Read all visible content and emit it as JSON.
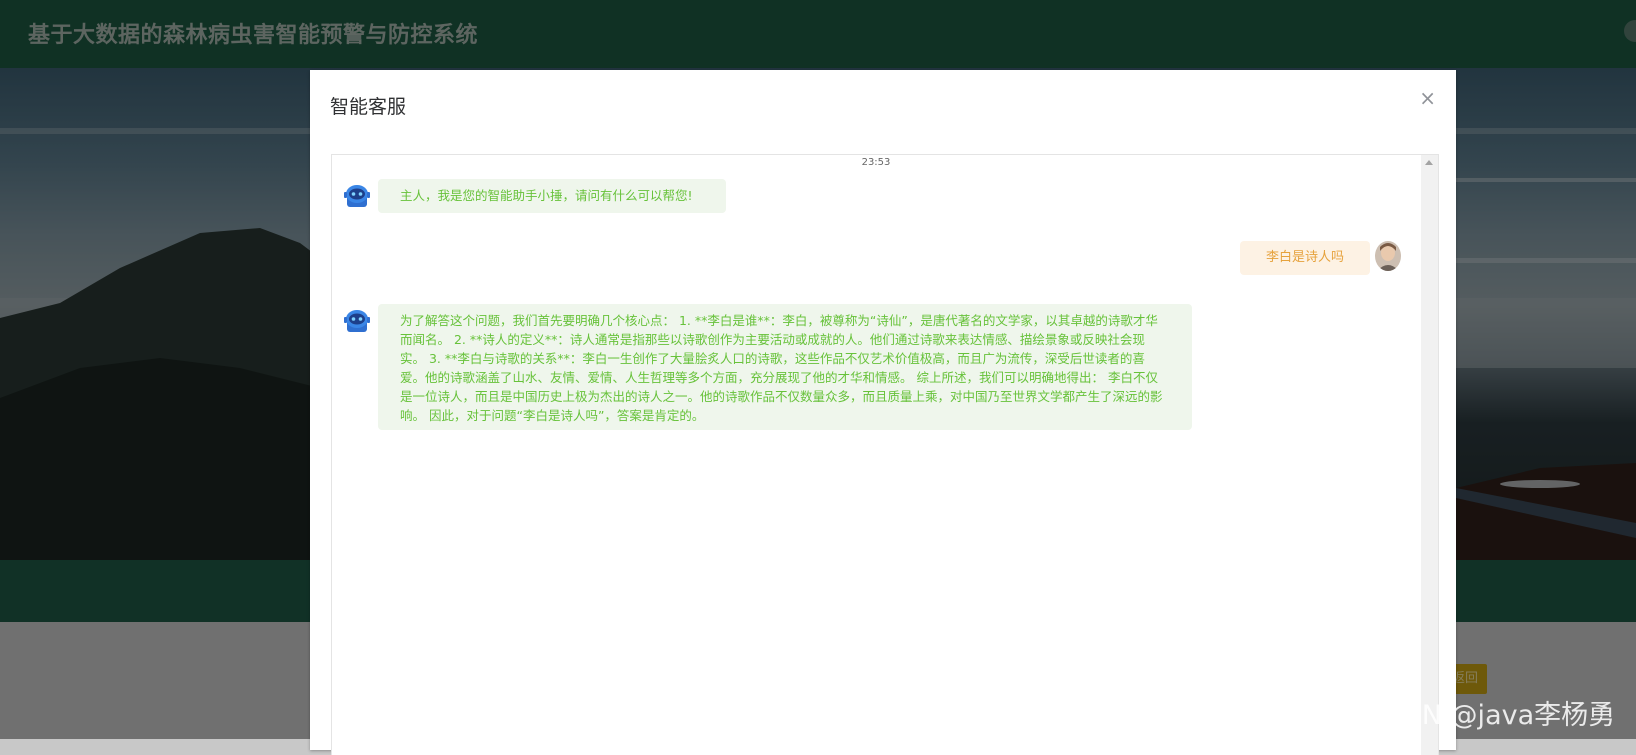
{
  "header": {
    "title": "基于大数据的森林病虫害智能预警与防控系统"
  },
  "background_page": {
    "return_button": "返回"
  },
  "dialog": {
    "title": "智能客服",
    "close_icon": "×",
    "timestamp": "23:53",
    "messages": [
      {
        "from": "bot",
        "text": "主人，我是您的智能助手小捶，请问有什么可以帮您!"
      },
      {
        "from": "user",
        "text": "李白是诗人吗"
      },
      {
        "from": "bot",
        "text": "为了解答这个问题，我们首先要明确几个核心点： 1. **李白是谁**：李白，被尊称为“诗仙”，是唐代著名的文学家，以其卓越的诗歌才华而闻名。 2. **诗人的定义**：诗人通常是指那些以诗歌创作为主要活动或成就的人。他们通过诗歌来表达情感、描绘景象或反映社会现实。 3. **李白与诗歌的关系**：李白一生创作了大量脍炙人口的诗歌，这些作品不仅艺术价值极高，而且广为流传，深受后世读者的喜爱。他的诗歌涵盖了山水、友情、爱情、人生哲理等多个方面，充分展现了他的才华和情感。 综上所述，我们可以明确地得出： 李白不仅是一位诗人，而且是中国历史上极为杰出的诗人之一。他的诗歌作品不仅数量众多，而且质量上乘，对中国乃至世界文学都产生了深远的影响。 因此，对于问题“李白是诗人吗”，答案是肯定的。"
      }
    ]
  },
  "watermark": "CSDN @java李杨勇",
  "colors": {
    "header_green": "#1e5a43",
    "bot_bubble_bg": "#eff6ec",
    "bot_text": "#67c23a",
    "user_bubble_bg": "#fdf2e4",
    "user_text": "#e6a23c",
    "button_gold": "#c9a313"
  },
  "icons": {
    "bot_avatar": "robot-icon",
    "user_avatar": "user-photo-avatar",
    "close": "close-icon"
  }
}
